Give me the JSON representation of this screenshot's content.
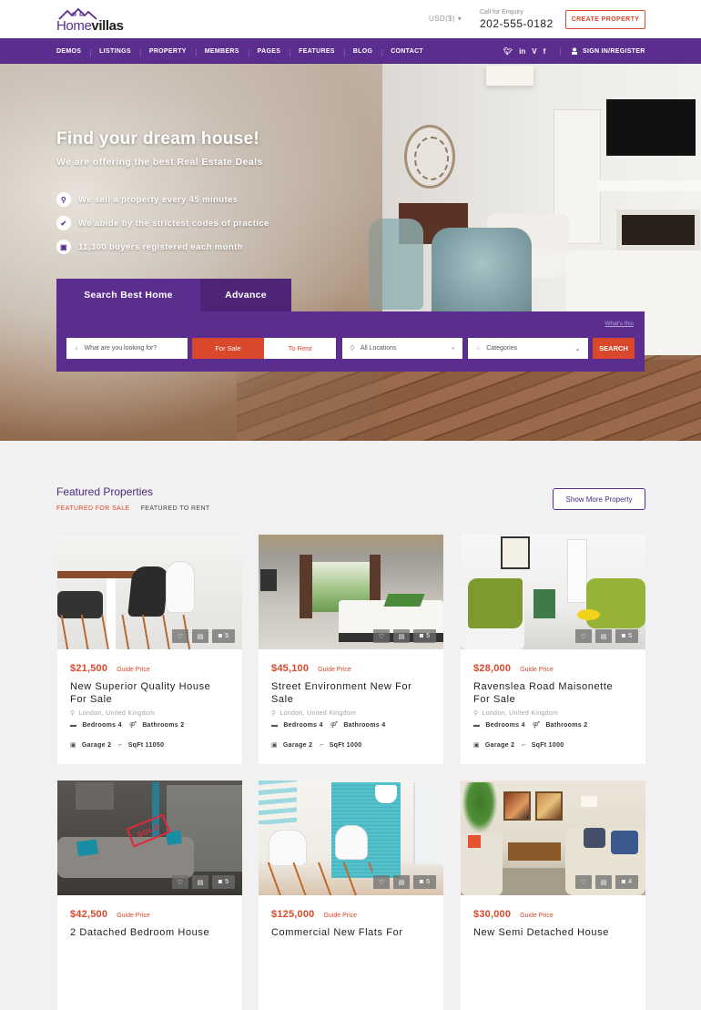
{
  "header": {
    "logo": {
      "part1": "Home",
      "part2": "villas"
    },
    "currency": "USD($) ▾",
    "enquiry_label": "Call for Enquiry",
    "enquiry_phone": "202-555-0182",
    "create_property": "CREATE PROPERTY"
  },
  "nav": {
    "items": [
      "DEMOS",
      "LISTINGS",
      "PROPERTY",
      "MEMBERS",
      "PAGES",
      "FEATURES",
      "BLOG",
      "CONTACT"
    ],
    "socials": [
      {
        "icon": "twitter-icon",
        "glyph": "🐦︎"
      },
      {
        "icon": "linkedin-icon",
        "glyph": "in"
      },
      {
        "icon": "vimeo-icon",
        "glyph": "V"
      },
      {
        "icon": "facebook-icon",
        "glyph": "f"
      }
    ],
    "signin": "SIGN IN/REGISTER"
  },
  "hero": {
    "title": "Find your dream house!",
    "subtitle": "We are offering the best Real Estate Deals",
    "features": [
      {
        "icon": "map-pin-icon",
        "text": "We sell a property every 45 minutes"
      },
      {
        "icon": "check-icon",
        "text": "We abide by the strictest codes of practice"
      },
      {
        "icon": "building-icon",
        "text": "11,300 buyers registered each month"
      }
    ]
  },
  "search": {
    "tabs": [
      "Search Best Home",
      "Advance"
    ],
    "whats_this": "What's this",
    "keyword_placeholder": "What are you looking for?",
    "for_sale": "For Sale",
    "to_rent": "To Rent",
    "location_placeholder": "All Locations",
    "category_placeholder": "Categories",
    "search_button": "SEARCH"
  },
  "featured": {
    "title": "Featured Properties",
    "tabs": [
      "FEATURED FOR SALE",
      "FEATURED TO RENT"
    ],
    "show_more": "Show More Property",
    "price_note": "Guide Price",
    "cards": [
      {
        "price": "$21,500",
        "title": "New Superior Quality House For Sale",
        "location": "London, United Kingdom",
        "bedrooms": "Bedrooms 4",
        "bathrooms": "Bathrooms 2",
        "garage": "Garage 2",
        "sqft": "SqFt 11050",
        "photos": "5",
        "sold": false
      },
      {
        "price": "$45,100",
        "title": "Street Environment New For Sale",
        "location": "London, United Kingdom",
        "bedrooms": "Bedrooms 4",
        "bathrooms": "Bathrooms 4",
        "garage": "Garage 2",
        "sqft": "SqFt 1000",
        "photos": "5",
        "sold": false
      },
      {
        "price": "$28,000",
        "title": "Ravenslea Road Maisonette For Sale",
        "location": "London, United Kingdom",
        "bedrooms": "Bedrooms 4",
        "bathrooms": "Bathrooms 2",
        "garage": "Garage 2",
        "sqft": "SqFt 1000",
        "photos": "5",
        "sold": false
      },
      {
        "price": "$42,500",
        "title": "2 Datached Bedroom House",
        "photos": "5",
        "sold": true,
        "sold_label": "SOLD"
      },
      {
        "price": "$125,000",
        "title": "Commercial New Flats For",
        "photos": "5",
        "sold": false
      },
      {
        "price": "$30,000",
        "title": "New Semi Detached House",
        "photos": "4",
        "sold": false
      }
    ]
  },
  "colors": {
    "brand_purple": "#5b2d8e",
    "accent_orange": "#d9482a",
    "page_bg": "#f1f1f1"
  }
}
